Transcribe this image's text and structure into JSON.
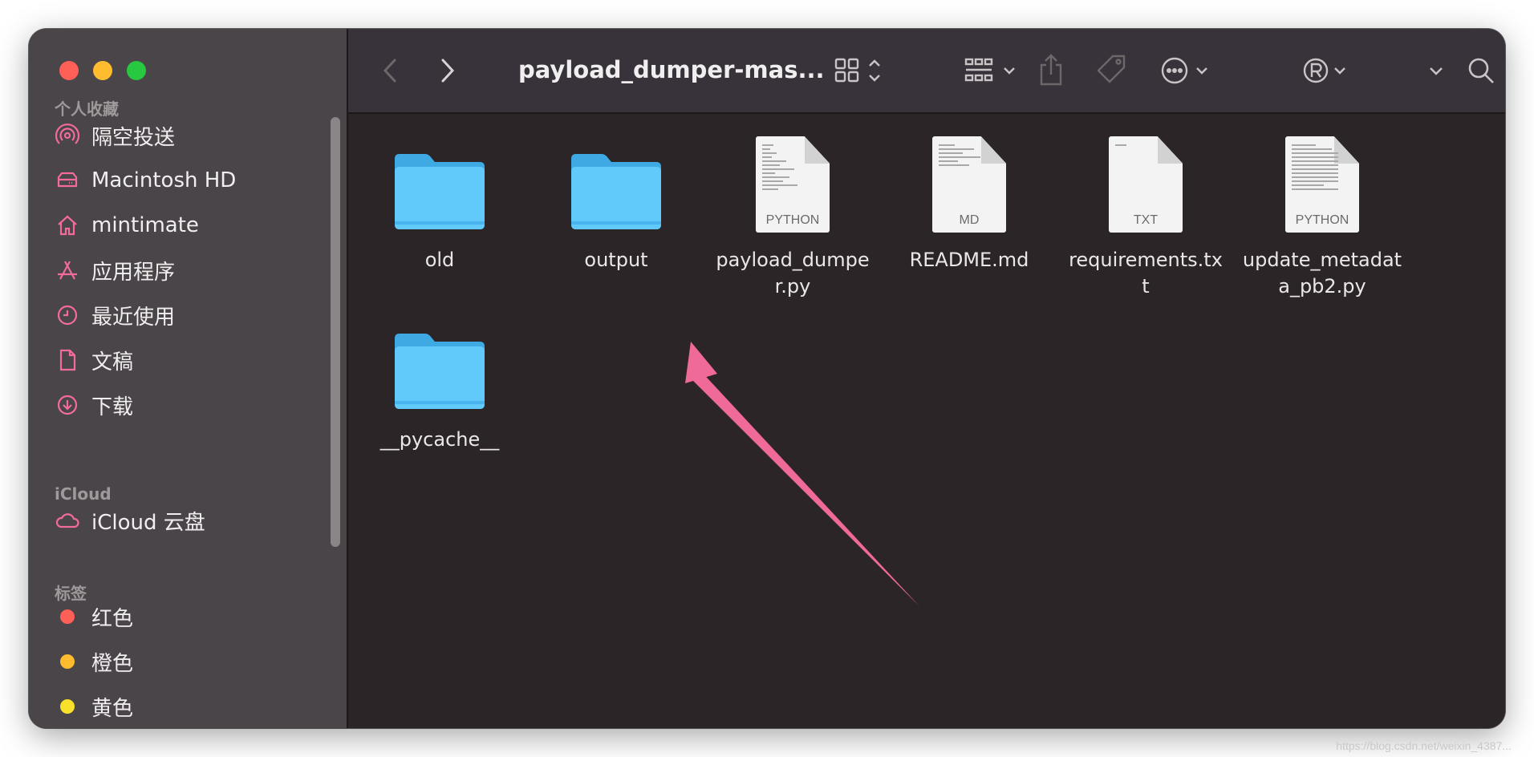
{
  "window": {
    "title": "payload_dumper-mas..."
  },
  "sidebar": {
    "favorites_title": "个人收藏",
    "favorites": [
      {
        "label": "隔空投送",
        "icon": "airdrop-icon"
      },
      {
        "label": "Macintosh HD",
        "icon": "drive-icon"
      },
      {
        "label": "mintimate",
        "icon": "home-icon"
      },
      {
        "label": "应用程序",
        "icon": "applications-icon"
      },
      {
        "label": "最近使用",
        "icon": "clock-icon"
      },
      {
        "label": "文稿",
        "icon": "document-icon"
      },
      {
        "label": "下载",
        "icon": "download-icon"
      }
    ],
    "icloud_title": "iCloud",
    "icloud": [
      {
        "label": "iCloud 云盘",
        "icon": "cloud-icon"
      }
    ],
    "tags_title": "标签",
    "tags": [
      {
        "label": "红色",
        "color": "#fe5f57"
      },
      {
        "label": "橙色",
        "color": "#febc2e"
      },
      {
        "label": "黄色",
        "color": "#f7e12a"
      }
    ]
  },
  "files": [
    {
      "name": "old",
      "kind": "folder"
    },
    {
      "name": "output",
      "kind": "folder"
    },
    {
      "name": "payload_dumper.py",
      "kind": "doc",
      "ext": "PYTHON"
    },
    {
      "name": "README.md",
      "kind": "doc",
      "ext": "MD"
    },
    {
      "name": "requirements.txt",
      "kind": "doc",
      "ext": "TXT"
    },
    {
      "name": "update_metadata_pb2.py",
      "kind": "doc",
      "ext": "PYTHON"
    },
    {
      "name": "__pycache__",
      "kind": "folder"
    }
  ],
  "colors": {
    "accent": "#f36b9c",
    "folder": "#5ec8f8",
    "arrow": "#ef6a98"
  },
  "watermark": "https://blog.csdn.net/weixin_4387..."
}
